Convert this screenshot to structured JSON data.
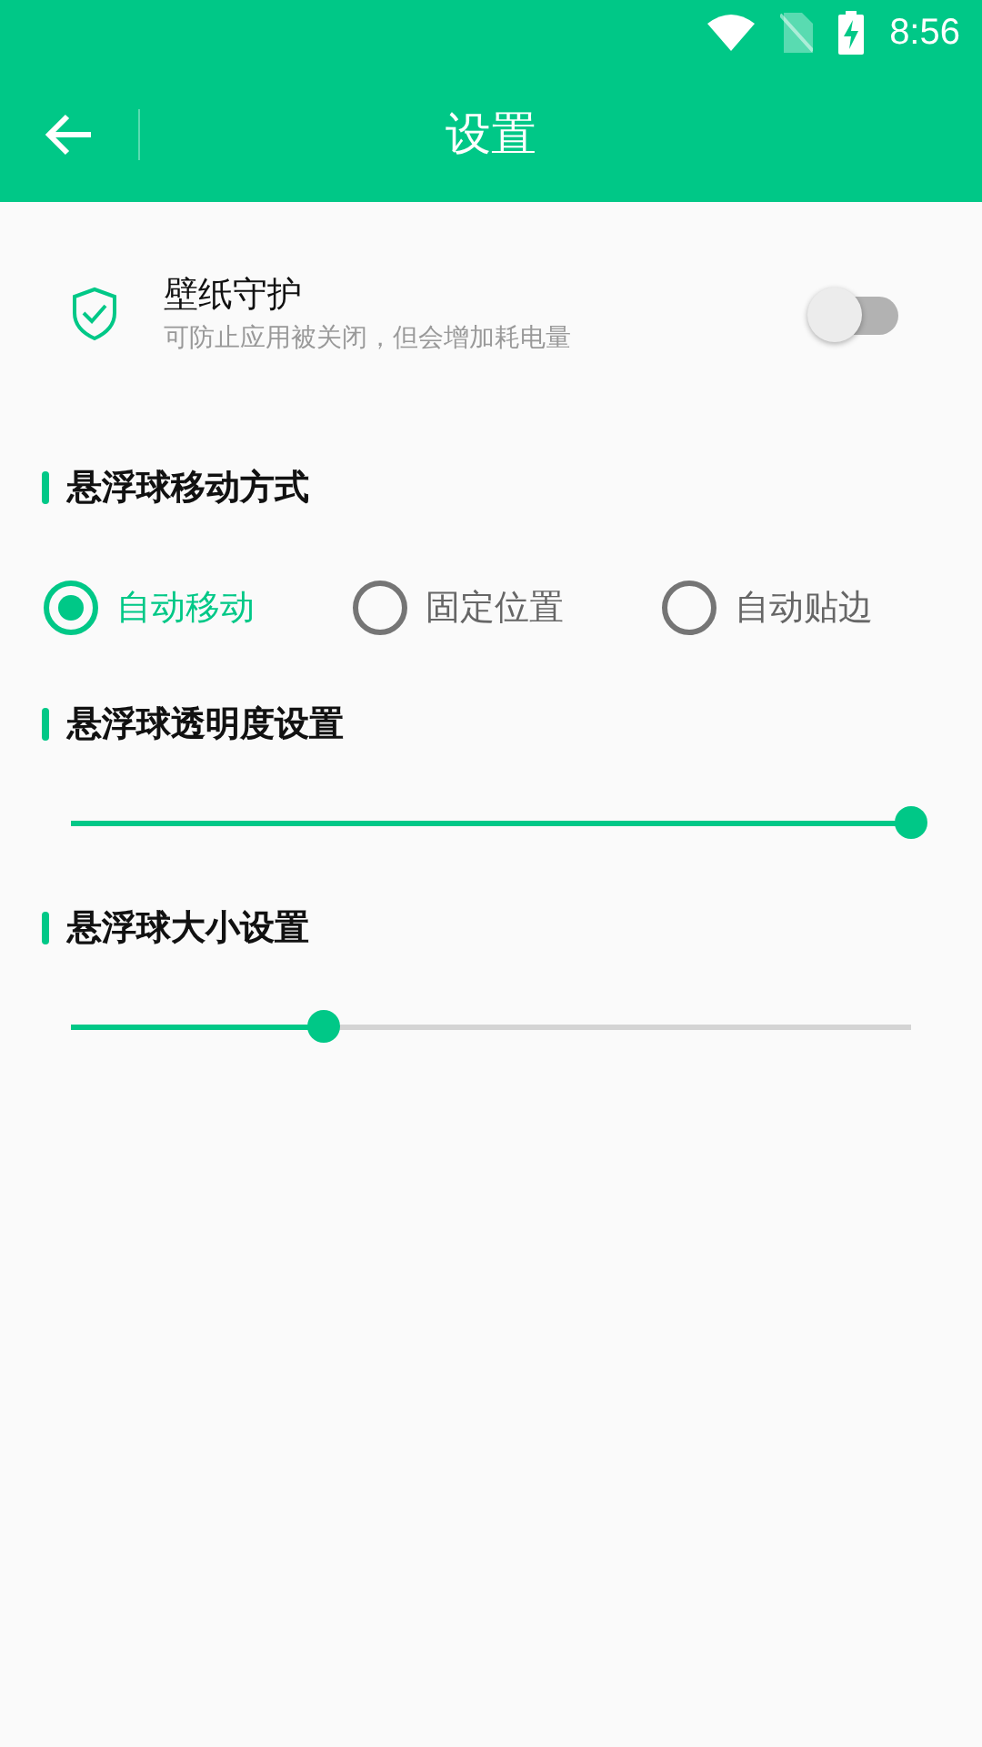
{
  "status_bar": {
    "time": "8:56"
  },
  "app_bar": {
    "title": "设置"
  },
  "wallpaper_guard": {
    "title": "壁纸守护",
    "subtitle": "可防止应用被关闭，但会增加耗电量",
    "on": false
  },
  "sections": [
    {
      "kind": "radio",
      "title": "悬浮球移动方式",
      "options": [
        {
          "label": "自动移动",
          "selected": true
        },
        {
          "label": "固定位置",
          "selected": false
        },
        {
          "label": "自动贴边",
          "selected": false
        }
      ]
    },
    {
      "kind": "slider",
      "title": "悬浮球透明度设置",
      "level": 1
    },
    {
      "kind": "slider",
      "title": "悬浮球大小设置",
      "level": 0.3
    }
  ]
}
